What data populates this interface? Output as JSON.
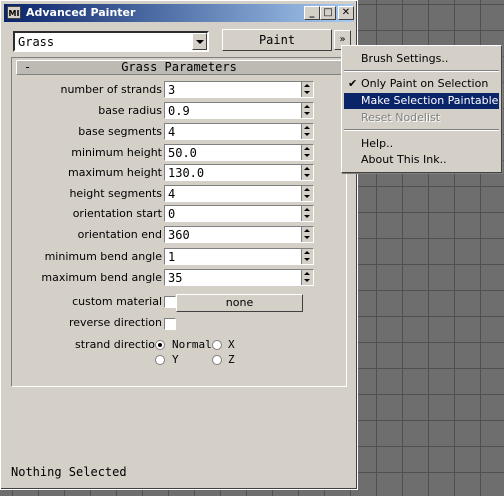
{
  "window": {
    "title": "Advanced Painter",
    "icon_text": "MI",
    "min_glyph": "_",
    "max_glyph": "□",
    "close_glyph": "✕"
  },
  "toolbar": {
    "brush_select_value": "Grass",
    "paint_label": "Paint",
    "more_glyph": "»"
  },
  "rollout": {
    "collapse_glyph": "-",
    "title": "Grass Parameters",
    "params": [
      {
        "label": "number of strands",
        "value": "3"
      },
      {
        "label": "base radius",
        "value": "0.9"
      },
      {
        "label": "base segments",
        "value": "4"
      },
      {
        "label": "minimum height",
        "value": "50.0"
      },
      {
        "label": "maximum height",
        "value": "130.0"
      },
      {
        "label": "height segments",
        "value": "4"
      },
      {
        "label": "orientation start",
        "value": "0"
      },
      {
        "label": "orientation end",
        "value": "360"
      },
      {
        "label": "minimum bend angle",
        "value": "1"
      },
      {
        "label": "maximum bend angle",
        "value": "35"
      }
    ],
    "custom_material_label": "custom material",
    "custom_material_button": "none",
    "reverse_direction_label": "reverse direction",
    "strand_direction_label": "strand direction",
    "strand_direction_options": [
      "Normal",
      "X",
      "Y",
      "Z"
    ],
    "strand_direction_selected": "Normal"
  },
  "status_text": "Nothing Selected",
  "menu": {
    "items": [
      {
        "label": "Brush Settings..",
        "checked": false,
        "selected": false,
        "disabled": false
      },
      {
        "label": "Only Paint on Selection",
        "checked": true,
        "selected": false,
        "disabled": false
      },
      {
        "label": "Make Selection Paintable",
        "checked": false,
        "selected": true,
        "disabled": false
      },
      {
        "label": "Reset Nodelist",
        "checked": false,
        "selected": false,
        "disabled": true
      },
      {
        "label": "Help..",
        "checked": false,
        "selected": false,
        "disabled": false
      },
      {
        "label": "About This Ink..",
        "checked": false,
        "selected": false,
        "disabled": false
      }
    ],
    "check_glyph": "✔"
  },
  "colors": {
    "titlebar_start": "#0a246a",
    "titlebar_end": "#a6caf0",
    "menu_highlight": "#0a246a",
    "dialog_face": "#d4d0c8",
    "viewport_bg": "#6e6e6e"
  }
}
